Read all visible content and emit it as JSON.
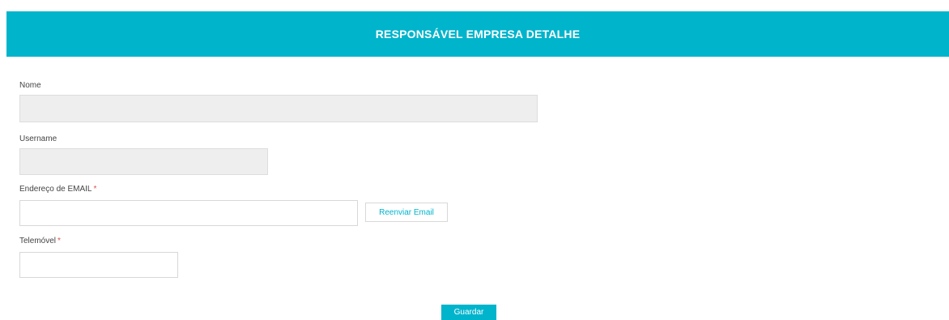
{
  "header": {
    "title": "RESPONSÁVEL EMPRESA DETALHE"
  },
  "form": {
    "nome": {
      "label": "Nome",
      "value": ""
    },
    "username": {
      "label": "Username",
      "value": ""
    },
    "email": {
      "label": "Endereço de EMAIL",
      "required_marker": "*",
      "value": "",
      "resend_label": "Reenviar Email"
    },
    "telemovel": {
      "label": "Telemóvel",
      "required_marker": "*",
      "value": ""
    },
    "save_label": "Guardar"
  },
  "colors": {
    "accent": "#00b4cc",
    "readonly_bg": "#eeeeee"
  }
}
